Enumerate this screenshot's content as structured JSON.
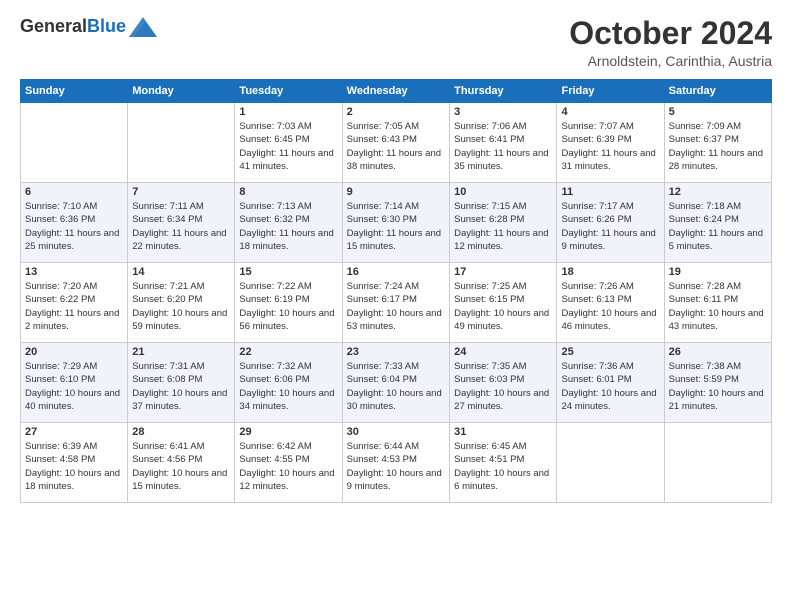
{
  "header": {
    "logo": {
      "general": "General",
      "blue": "Blue"
    },
    "title": "October 2024",
    "location": "Arnoldstein, Carinthia, Austria"
  },
  "days_of_week": [
    "Sunday",
    "Monday",
    "Tuesday",
    "Wednesday",
    "Thursday",
    "Friday",
    "Saturday"
  ],
  "weeks": [
    [
      {
        "day": "",
        "info": ""
      },
      {
        "day": "",
        "info": ""
      },
      {
        "day": "1",
        "info": "Sunrise: 7:03 AM\nSunset: 6:45 PM\nDaylight: 11 hours and 41 minutes."
      },
      {
        "day": "2",
        "info": "Sunrise: 7:05 AM\nSunset: 6:43 PM\nDaylight: 11 hours and 38 minutes."
      },
      {
        "day": "3",
        "info": "Sunrise: 7:06 AM\nSunset: 6:41 PM\nDaylight: 11 hours and 35 minutes."
      },
      {
        "day": "4",
        "info": "Sunrise: 7:07 AM\nSunset: 6:39 PM\nDaylight: 11 hours and 31 minutes."
      },
      {
        "day": "5",
        "info": "Sunrise: 7:09 AM\nSunset: 6:37 PM\nDaylight: 11 hours and 28 minutes."
      }
    ],
    [
      {
        "day": "6",
        "info": "Sunrise: 7:10 AM\nSunset: 6:36 PM\nDaylight: 11 hours and 25 minutes."
      },
      {
        "day": "7",
        "info": "Sunrise: 7:11 AM\nSunset: 6:34 PM\nDaylight: 11 hours and 22 minutes."
      },
      {
        "day": "8",
        "info": "Sunrise: 7:13 AM\nSunset: 6:32 PM\nDaylight: 11 hours and 18 minutes."
      },
      {
        "day": "9",
        "info": "Sunrise: 7:14 AM\nSunset: 6:30 PM\nDaylight: 11 hours and 15 minutes."
      },
      {
        "day": "10",
        "info": "Sunrise: 7:15 AM\nSunset: 6:28 PM\nDaylight: 11 hours and 12 minutes."
      },
      {
        "day": "11",
        "info": "Sunrise: 7:17 AM\nSunset: 6:26 PM\nDaylight: 11 hours and 9 minutes."
      },
      {
        "day": "12",
        "info": "Sunrise: 7:18 AM\nSunset: 6:24 PM\nDaylight: 11 hours and 5 minutes."
      }
    ],
    [
      {
        "day": "13",
        "info": "Sunrise: 7:20 AM\nSunset: 6:22 PM\nDaylight: 11 hours and 2 minutes."
      },
      {
        "day": "14",
        "info": "Sunrise: 7:21 AM\nSunset: 6:20 PM\nDaylight: 10 hours and 59 minutes."
      },
      {
        "day": "15",
        "info": "Sunrise: 7:22 AM\nSunset: 6:19 PM\nDaylight: 10 hours and 56 minutes."
      },
      {
        "day": "16",
        "info": "Sunrise: 7:24 AM\nSunset: 6:17 PM\nDaylight: 10 hours and 53 minutes."
      },
      {
        "day": "17",
        "info": "Sunrise: 7:25 AM\nSunset: 6:15 PM\nDaylight: 10 hours and 49 minutes."
      },
      {
        "day": "18",
        "info": "Sunrise: 7:26 AM\nSunset: 6:13 PM\nDaylight: 10 hours and 46 minutes."
      },
      {
        "day": "19",
        "info": "Sunrise: 7:28 AM\nSunset: 6:11 PM\nDaylight: 10 hours and 43 minutes."
      }
    ],
    [
      {
        "day": "20",
        "info": "Sunrise: 7:29 AM\nSunset: 6:10 PM\nDaylight: 10 hours and 40 minutes."
      },
      {
        "day": "21",
        "info": "Sunrise: 7:31 AM\nSunset: 6:08 PM\nDaylight: 10 hours and 37 minutes."
      },
      {
        "day": "22",
        "info": "Sunrise: 7:32 AM\nSunset: 6:06 PM\nDaylight: 10 hours and 34 minutes."
      },
      {
        "day": "23",
        "info": "Sunrise: 7:33 AM\nSunset: 6:04 PM\nDaylight: 10 hours and 30 minutes."
      },
      {
        "day": "24",
        "info": "Sunrise: 7:35 AM\nSunset: 6:03 PM\nDaylight: 10 hours and 27 minutes."
      },
      {
        "day": "25",
        "info": "Sunrise: 7:36 AM\nSunset: 6:01 PM\nDaylight: 10 hours and 24 minutes."
      },
      {
        "day": "26",
        "info": "Sunrise: 7:38 AM\nSunset: 5:59 PM\nDaylight: 10 hours and 21 minutes."
      }
    ],
    [
      {
        "day": "27",
        "info": "Sunrise: 6:39 AM\nSunset: 4:58 PM\nDaylight: 10 hours and 18 minutes."
      },
      {
        "day": "28",
        "info": "Sunrise: 6:41 AM\nSunset: 4:56 PM\nDaylight: 10 hours and 15 minutes."
      },
      {
        "day": "29",
        "info": "Sunrise: 6:42 AM\nSunset: 4:55 PM\nDaylight: 10 hours and 12 minutes."
      },
      {
        "day": "30",
        "info": "Sunrise: 6:44 AM\nSunset: 4:53 PM\nDaylight: 10 hours and 9 minutes."
      },
      {
        "day": "31",
        "info": "Sunrise: 6:45 AM\nSunset: 4:51 PM\nDaylight: 10 hours and 6 minutes."
      },
      {
        "day": "",
        "info": ""
      },
      {
        "day": "",
        "info": ""
      }
    ]
  ]
}
